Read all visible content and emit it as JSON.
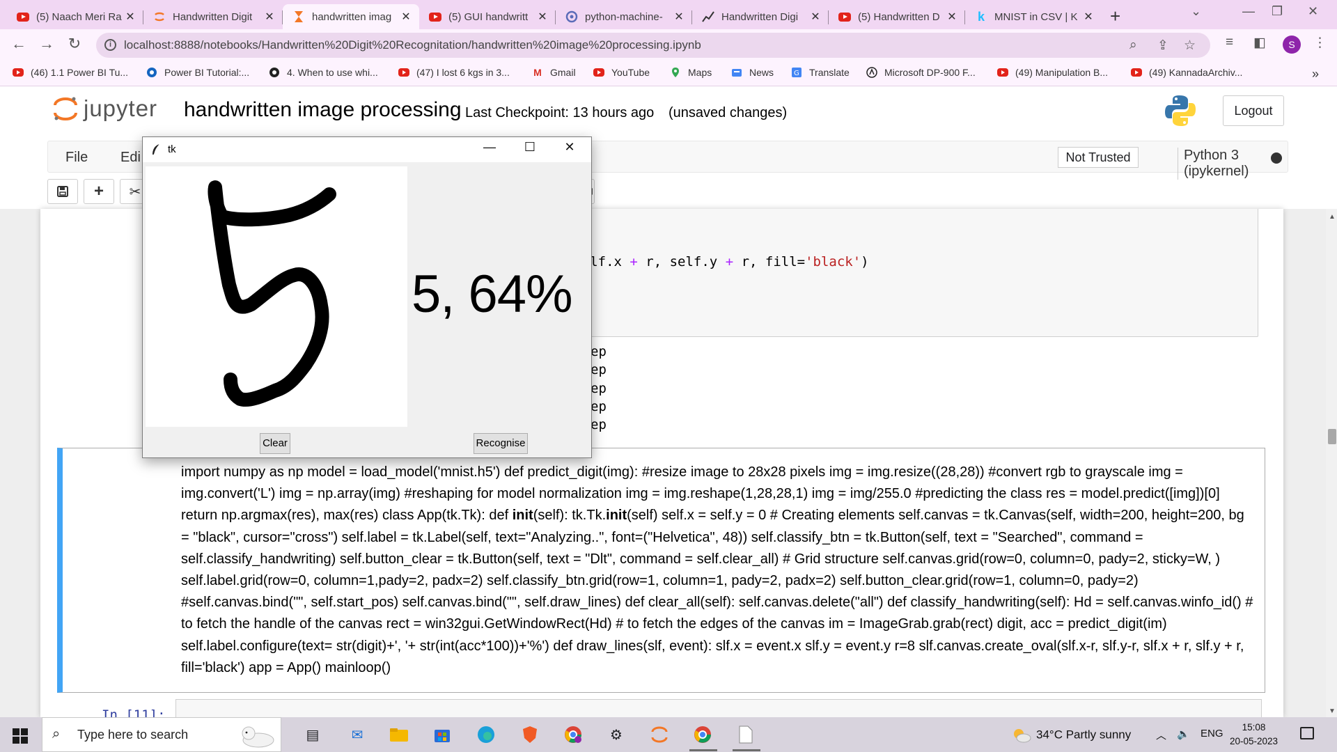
{
  "browser": {
    "tabs": [
      {
        "title": "(5) Naach Meri Ra",
        "icon": "youtube-icon"
      },
      {
        "title": "Handwritten Digit",
        "icon": "jupyter-icon"
      },
      {
        "title": "handwritten imag",
        "icon": "hourglass-icon",
        "active": true
      },
      {
        "title": "(5) GUI handwritt",
        "icon": "youtube-icon"
      },
      {
        "title": "python-machine-",
        "icon": "github-icon"
      },
      {
        "title": "Handwritten Digi",
        "icon": "chart-icon"
      },
      {
        "title": "(5) Handwritten D",
        "icon": "youtube-icon"
      },
      {
        "title": "MNIST in CSV | K",
        "icon": "kaggle-icon"
      }
    ],
    "url": "localhost:8888/notebooks/Handwritten%20Digit%20Recognitation/handwritten%20image%20processing.ipynb",
    "profile_initial": "S",
    "bookmarks": [
      {
        "label": "(46) 1.1 Power BI Tu...",
        "icon": "youtube-icon"
      },
      {
        "label": "Power BI Tutorial:...",
        "icon": "powerbi-icon"
      },
      {
        "label": "4. When to use whi...",
        "icon": "site-icon"
      },
      {
        "label": "(47) I lost 6 kgs in 3...",
        "icon": "youtube-icon"
      },
      {
        "label": "Gmail",
        "icon": "gmail-icon"
      },
      {
        "label": "YouTube",
        "icon": "youtube-icon"
      },
      {
        "label": "Maps",
        "icon": "maps-icon"
      },
      {
        "label": "News",
        "icon": "news-icon"
      },
      {
        "label": "Translate",
        "icon": "translate-icon"
      },
      {
        "label": "Microsoft DP-900 F...",
        "icon": "site-icon"
      },
      {
        "label": "(49) Manipulation B...",
        "icon": "youtube-icon"
      },
      {
        "label": "(49) KannadaArchiv...",
        "icon": "youtube-icon"
      }
    ]
  },
  "jupyter": {
    "logo_text": "jupyter",
    "notebook_title": "handwritten image processing",
    "checkpoint": "Last Checkpoint: 13 hours ago",
    "unsaved": "(unsaved changes)",
    "logout_label": "Logout",
    "menu": [
      "File",
      "Edi"
    ],
    "trust_label": "Not Trusted",
    "kernel_label": "Python 3 (ipykernel)"
  },
  "notebook": {
    "code_line_prefix": "r, self.x ",
    "code_line_mid1": " r, self.y ",
    "code_line_mid2": " r, fill=",
    "code_line_str": "'black'",
    "code_line_end": ")",
    "plus": "+",
    "output_lines": [
      "ep",
      "ep",
      "ep",
      "ep",
      "ep"
    ],
    "markdown_parts": [
      "import numpy as np model = load_model('mnist.h5') def predict_digit(img): #resize image to 28x28 pixels img = img.resize((28,28)) #convert rgb to grayscale img = img.convert('L') img = np.array(img) #reshaping for model normalization img = img.reshape(1,28,28,1) img = img/255.0 #predicting the class res = model.predict([img])[0] return np.argmax(res), max(res) class App(tk.Tk): def ",
      "init",
      "(self): tk.Tk.",
      "init",
      "(self) self.x = self.y = 0 # Creating elements self.canvas = tk.Canvas(self, width=200, height=200, bg = \"black\", cursor=\"cross\") self.label = tk.Label(self, text=\"Analyzing..\", font=(\"Helvetica\", 48)) self.classify_btn = tk.Button(self, text = \"Searched\", command = self.classify_handwriting) self.button_clear = tk.Button(self, text = \"Dlt\", command = self.clear_all) # Grid structure self.canvas.grid(row=0, column=0, pady=2, sticky=W, ) self.label.grid(row=0, column=1,pady=2, padx=2) self.classify_btn.grid(row=1, column=1, pady=2, padx=2) self.button_clear.grid(row=1, column=0, pady=2) #self.canvas.bind(\"\", self.start_pos) self.canvas.bind(\"\", self.draw_lines) def clear_all(self): self.canvas.delete(\"all\") def classify_handwriting(self): Hd = self.canvas.winfo_id() # to fetch the handle of the canvas rect = win32gui.GetWindowRect(Hd) # to fetch the edges of the canvas im = ImageGrab.grab(rect) digit, acc = predict_digit(im) self.label.configure(text= str(digit)+', '+ str(int(acc*100))+'%') def draw_lines(slf, event): slf.x = event.x slf.y = event.y r=8 slf.canvas.create_oval(slf.x-r, slf.y-r, slf.x + r, slf.y + r, fill='black') app = App() mainloop()"
    ],
    "next_prompt": "In [11]:"
  },
  "tk_window": {
    "title": "tk",
    "result": "5, 64%",
    "predicted_digit": 5,
    "confidence_percent": 64,
    "clear_label": "Clear",
    "recognise_label": "Recognise"
  },
  "taskbar": {
    "search_placeholder": "Type here to search",
    "weather": "34°C  Partly sunny",
    "language": "ENG",
    "time": "15:08",
    "date": "20-05-2023"
  },
  "colors": {
    "tab_strip": "#f1d7f3",
    "toolbar": "#fdf3fe",
    "jupyter_orange": "#f37726",
    "cell_selected": "#42a5f5"
  }
}
